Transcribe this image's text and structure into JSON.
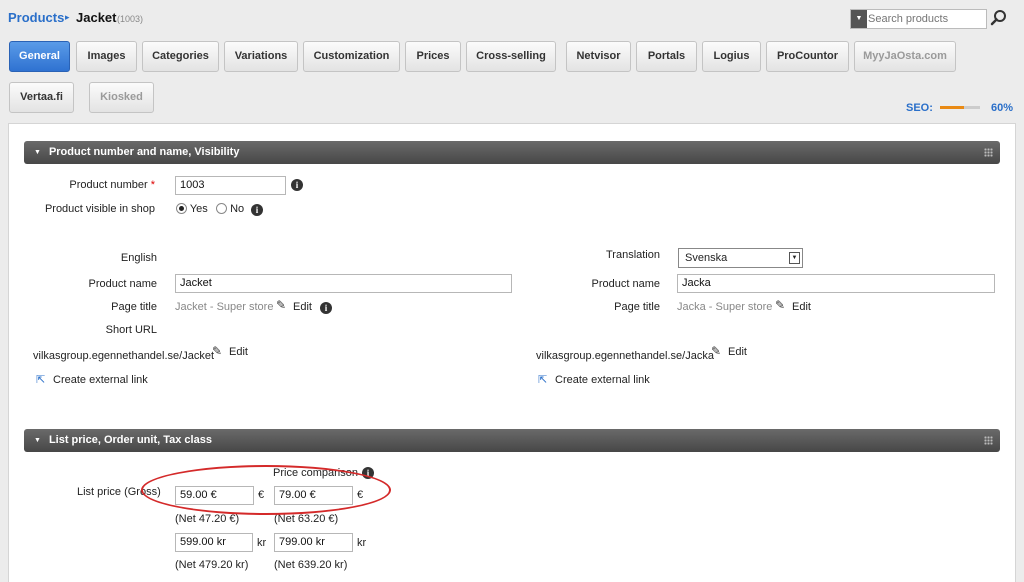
{
  "breadcrumb": {
    "root": "Products",
    "separator": "▸",
    "title": "Jacket",
    "id": "(1003)"
  },
  "search": {
    "placeholder": "Search products"
  },
  "tabs": [
    {
      "label": "General",
      "state": "active"
    },
    {
      "label": "Images",
      "state": "normal"
    },
    {
      "label": "Categories",
      "state": "normal"
    },
    {
      "label": "Variations",
      "state": "normal"
    },
    {
      "label": "Customization",
      "state": "normal"
    },
    {
      "label": "Prices",
      "state": "normal"
    },
    {
      "label": "Cross-selling",
      "state": "normal"
    },
    {
      "label": "Netvisor",
      "state": "normal"
    },
    {
      "label": "Portals",
      "state": "normal"
    },
    {
      "label": "Logius",
      "state": "normal"
    },
    {
      "label": "ProCountor",
      "state": "normal"
    },
    {
      "label": "MyyJaOsta.com",
      "state": "disabled"
    },
    {
      "label": "Vertaa.fi",
      "state": "normal"
    },
    {
      "label": "Kiosked",
      "state": "disabled"
    }
  ],
  "seo": {
    "label": "SEO:",
    "percent_text": "60%",
    "value": 0.6,
    "bar_color": "#e98a14"
  },
  "section1": {
    "title": "Product number and name, Visibility",
    "product_number_label": "Product number",
    "required_mark": "*",
    "product_number_value": "1003",
    "visible_label": "Product visible in shop",
    "yes_label": "Yes",
    "no_label": "No",
    "visible_selected": "Yes",
    "left": {
      "language": "English",
      "product_name_label": "Product name",
      "product_name_value": "Jacket",
      "page_title_label": "Page title",
      "page_title_value": "Jacket - Super store",
      "edit_label": "Edit",
      "short_url_label": "Short URL",
      "short_url_value": "vilkasgroup.egennethandel.se/Jacket",
      "short_url_edit": "Edit",
      "external_link": "Create external link"
    },
    "right": {
      "translation_label": "Translation",
      "translation_value": "Svenska",
      "product_name_label": "Product name",
      "product_name_value": "Jacka",
      "page_title_label": "Page title",
      "page_title_value": "Jacka - Super store",
      "edit_label": "Edit",
      "short_url_value": "vilkasgroup.egennethandel.se/Jacka",
      "short_url_edit": "Edit",
      "external_link": "Create external link"
    }
  },
  "section2": {
    "title": "List price, Order unit, Tax class",
    "price_comparison_label": "Price comparison",
    "list_price_label": "List price (Gross)",
    "eur": {
      "price": "59.00 €",
      "compare": "79.00 €",
      "currency": "€",
      "net_price": "(Net 47.20 €)",
      "net_compare": "(Net 63.20 €)"
    },
    "sek": {
      "price": "599.00 kr",
      "compare": "799.00 kr",
      "currency": "kr",
      "net_price": "(Net 479.20 kr)",
      "net_compare": "(Net 639.20 kr)"
    },
    "highlight_color": "#d42a2a"
  }
}
